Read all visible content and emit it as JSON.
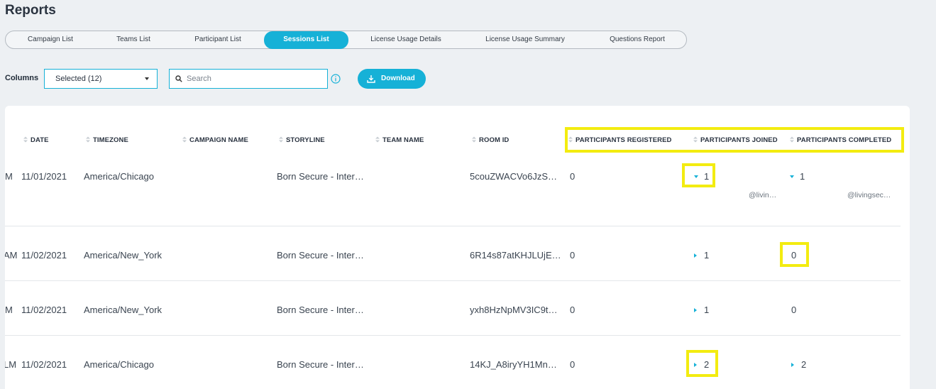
{
  "page": {
    "title": "Reports"
  },
  "tabs": [
    {
      "label": "Campaign List",
      "active": false
    },
    {
      "label": "Teams List",
      "active": false
    },
    {
      "label": "Participant List",
      "active": false
    },
    {
      "label": "Sessions List",
      "active": true
    },
    {
      "label": "License Usage Details",
      "active": false
    },
    {
      "label": "License Usage Summary",
      "active": false
    },
    {
      "label": "Questions Report",
      "active": false
    }
  ],
  "toolbar": {
    "columns_label": "Columns",
    "columns_select_value": "Selected (12)",
    "search_placeholder": "Search",
    "download_label": "Download"
  },
  "table": {
    "headers": {
      "date": "DATE",
      "timezone": "TIMEZONE",
      "campaign_name": "CAMPAIGN NAME",
      "storyline": "STORYLINE",
      "team_name": "TEAM NAME",
      "room_id": "ROOM ID",
      "participants_registered": "PARTICIPANTS REGISTERED",
      "participants_joined": "PARTICIPANTS JOINED",
      "participants_completed": "PARTICIPANTS COMPLETED"
    },
    "rows": [
      {
        "time_clip": "M",
        "date": "11/01/2021",
        "timezone": "America/Chicago",
        "storyline": "Born Secure - Inter…",
        "room_id": "5couZWACVo6JzS…",
        "registered": "0",
        "joined": "1",
        "joined_expanded": true,
        "joined_detail": "@livin…",
        "completed": "1",
        "completed_expanded": true,
        "completed_detail": "@livingsec…"
      },
      {
        "time_clip": "AM",
        "date": "11/02/2021",
        "timezone": "America/New_York",
        "storyline": "Born Secure - Inter…",
        "room_id": "6R14s87atKHJLUjE…",
        "registered": "0",
        "joined": "1",
        "joined_expanded": false,
        "completed": "0"
      },
      {
        "time_clip": "M",
        "date": "11/02/2021",
        "timezone": "America/New_York",
        "storyline": "Born Secure - Inter…",
        "room_id": "yxh8HzNpMV3IC9t…",
        "registered": "0",
        "joined": "1",
        "joined_expanded": false,
        "completed": "0"
      },
      {
        "time_clip": "LM",
        "date": "11/02/2021",
        "timezone": "America/Chicago",
        "storyline": "Born Secure - Inter…",
        "room_id": "14KJ_A8iryYH1Mn…",
        "registered": "0",
        "joined": "2",
        "joined_expanded": false,
        "completed": "2",
        "completed_expanded": false
      }
    ]
  },
  "colors": {
    "accent": "#16b1d7",
    "highlight": "#f3ec10",
    "background": "#edf0f3"
  }
}
